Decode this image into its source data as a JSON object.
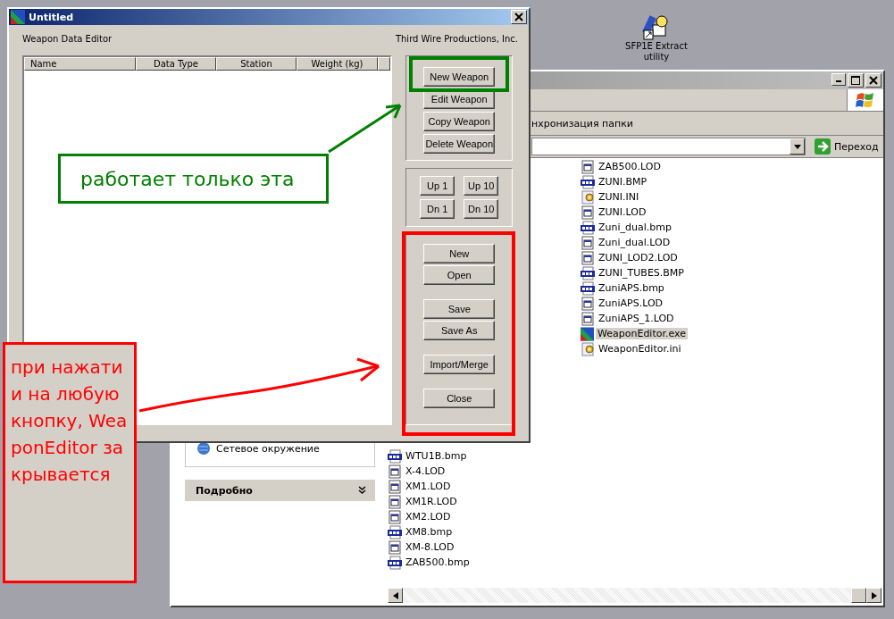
{
  "desktop_icon": {
    "label": "SFP1E Extract utility"
  },
  "explorer": {
    "toolbar_text": "нхронизация папки",
    "go_button": "Переход",
    "task_pane": {
      "items": [
        {
          "label": "Сетевое окружение"
        }
      ],
      "details_header": "Подробно"
    },
    "file_columns": [
      [
        {
          "name": "WTU1B.bmp",
          "kind": "bmp",
          "selected": false
        },
        {
          "name": "X-4.LOD",
          "kind": "lod",
          "selected": false
        },
        {
          "name": "XM1.LOD",
          "kind": "lod",
          "selected": false
        },
        {
          "name": "XM1R.LOD",
          "kind": "lod",
          "selected": false
        },
        {
          "name": "XM2.LOD",
          "kind": "lod",
          "selected": false
        },
        {
          "name": "XM8.bmp",
          "kind": "bmp",
          "selected": false
        },
        {
          "name": "XM-8.LOD",
          "kind": "lod",
          "selected": false
        },
        {
          "name": "ZAB500.bmp",
          "kind": "bmp",
          "selected": false
        }
      ],
      [
        {
          "name": "ZAB500.LOD",
          "kind": "lod",
          "selected": false
        },
        {
          "name": "ZUNI.BMP",
          "kind": "bmp",
          "selected": false
        },
        {
          "name": "ZUNI.INI",
          "kind": "ini",
          "selected": false
        },
        {
          "name": "ZUNI.LOD",
          "kind": "lod",
          "selected": false
        },
        {
          "name": "Zuni_dual.bmp",
          "kind": "bmp",
          "selected": false
        },
        {
          "name": "Zuni_dual.LOD",
          "kind": "lod",
          "selected": false
        },
        {
          "name": "ZUNI_LOD2.LOD",
          "kind": "lod",
          "selected": false
        },
        {
          "name": "ZUNI_TUBES.BMP",
          "kind": "bmp",
          "selected": false
        },
        {
          "name": "ZuniAPS.bmp",
          "kind": "bmp",
          "selected": false
        },
        {
          "name": "ZuniAPS.LOD",
          "kind": "lod",
          "selected": false
        },
        {
          "name": "ZuniAPS_1.LOD",
          "kind": "lod",
          "selected": false
        },
        {
          "name": "WeaponEditor.exe",
          "kind": "exe",
          "selected": true
        },
        {
          "name": "WeaponEditor.ini",
          "kind": "ini",
          "selected": false
        }
      ]
    ]
  },
  "editor": {
    "title": "Untitled",
    "subtitle": "Weapon Data Editor",
    "company": "Third Wire Productions, Inc.",
    "columns": [
      "Name",
      "Data Type",
      "Station",
      "Weight (kg)"
    ],
    "button_groups": [
      {
        "kind": "stack",
        "sets": [
          [
            "New Weapon",
            "Edit Weapon",
            "Copy Weapon",
            "Delete Weapon"
          ]
        ]
      },
      {
        "kind": "grid",
        "sets": [
          [
            "Up 1",
            "Up 10"
          ],
          [
            "Dn 1",
            "Dn 10"
          ]
        ]
      },
      {
        "kind": "stack",
        "sets": [
          [
            "New",
            "Open"
          ],
          [
            "Save",
            "Save As"
          ],
          [
            "Import/Merge"
          ],
          [
            "Close"
          ]
        ]
      }
    ]
  },
  "annotations": [
    {
      "kind": "frame",
      "color": "#008000"
    },
    {
      "kind": "note",
      "text": "работает только эта",
      "color": "#008000"
    },
    {
      "kind": "arrow",
      "color": "#008000"
    },
    {
      "kind": "frame",
      "color": "#ff0000"
    },
    {
      "kind": "note",
      "text": "при нажатии на любую кнопку, WeaponEditor закрывается",
      "color": "#ff0000"
    },
    {
      "kind": "arrow",
      "color": "#ff0000"
    }
  ]
}
